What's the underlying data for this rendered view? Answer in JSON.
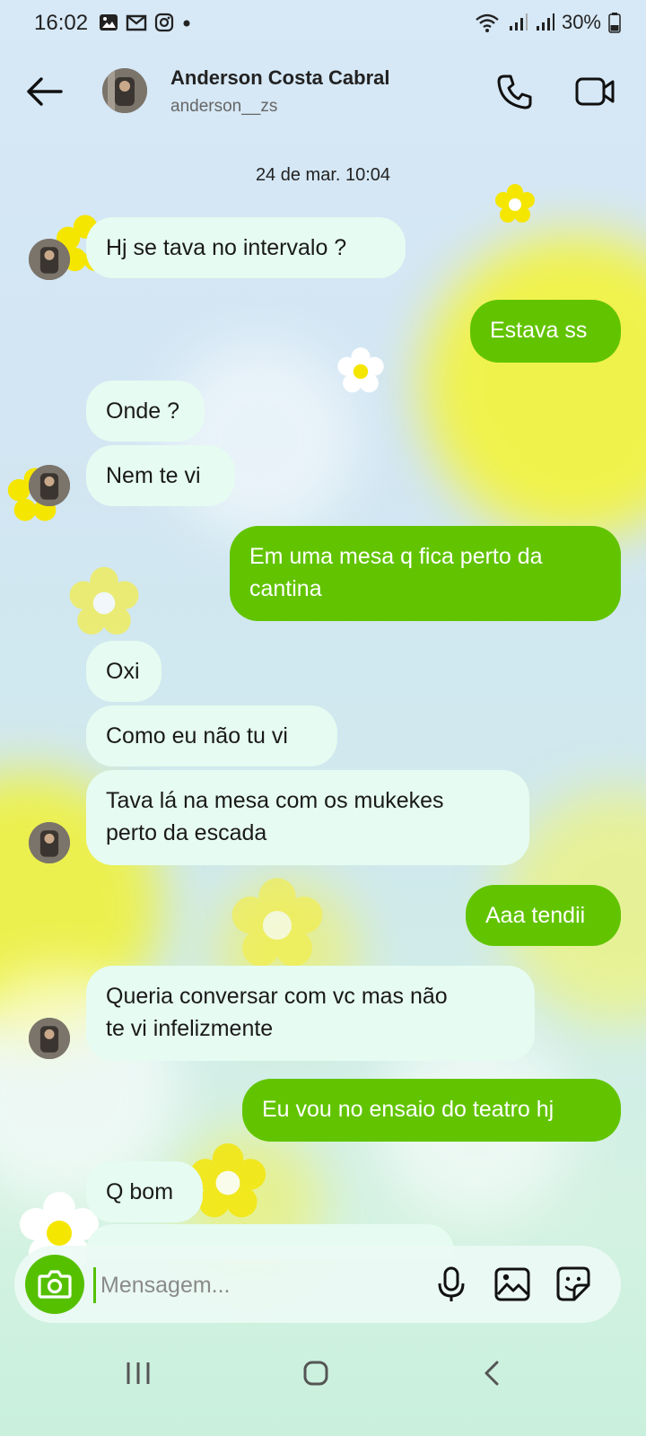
{
  "status_bar": {
    "time": "16:02",
    "battery": "30%",
    "left_icons": [
      "gallery-icon",
      "gmail-icon",
      "instagram-icon",
      "dot-icon"
    ],
    "right_icons": [
      "wifi-icon",
      "signal-icon",
      "signal-icon",
      "battery-icon"
    ]
  },
  "header": {
    "name": "Anderson Costa Cabral",
    "username": "anderson__zs",
    "back_icon": "arrow-left-icon",
    "call_icon": "phone-icon",
    "video_icon": "video-camera-icon"
  },
  "conversation": {
    "date_separator": "24 de mar. 10:04",
    "messages": [
      {
        "direction": "incoming",
        "lines": [
          "Hj se tava no intervalo ?"
        ]
      },
      {
        "direction": "outgoing",
        "lines": [
          "Estava ss"
        ]
      },
      {
        "direction": "incoming",
        "lines": [
          "Onde ?"
        ]
      },
      {
        "direction": "incoming",
        "lines": [
          "Nem te vi"
        ]
      },
      {
        "direction": "outgoing",
        "lines": [
          "Em uma mesa q fica perto da",
          "cantina"
        ]
      },
      {
        "direction": "incoming",
        "lines": [
          "Oxi"
        ]
      },
      {
        "direction": "incoming",
        "lines": [
          "Como eu não tu vi"
        ]
      },
      {
        "direction": "incoming",
        "lines": [
          "Tava lá na mesa com os mukekes",
          "perto da escada"
        ]
      },
      {
        "direction": "outgoing",
        "lines": [
          "Aaa tendii"
        ]
      },
      {
        "direction": "incoming",
        "lines": [
          "Queria conversar com vc mas não",
          "te vi infelizmente"
        ]
      },
      {
        "direction": "outgoing",
        "lines": [
          "Eu vou no ensaio do teatro hj"
        ]
      },
      {
        "direction": "incoming",
        "lines": [
          "Q bom"
        ]
      }
    ]
  },
  "composer": {
    "placeholder": "Mensagem...",
    "value": "",
    "camera_icon": "camera-icon",
    "mic_icon": "microphone-icon",
    "gallery_icon": "image-icon",
    "sticker_icon": "sticker-icon"
  },
  "nav_bar": {
    "buttons": [
      "recent-apps-icon",
      "home-icon",
      "back-icon"
    ]
  },
  "colors": {
    "outgoing_bubble": "#62c400",
    "incoming_bubble": "#e6fbf1",
    "accent": "#55c000"
  }
}
